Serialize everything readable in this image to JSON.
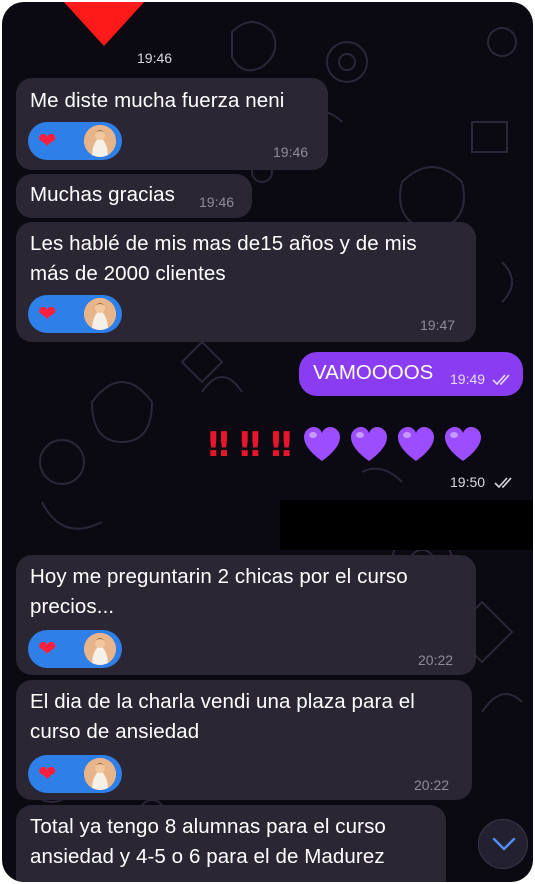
{
  "colors": {
    "background": "#0b0912",
    "incoming_bubble": "#2a2634",
    "outgoing_bubble": "#8a3cf0",
    "reaction_pill": "#2f7fe8",
    "heart_red": "#ff1f3d",
    "heart_purple": "#9b4dff"
  },
  "chat": {
    "top_time": "19:46",
    "messages": [
      {
        "text": "Me diste mucha fuerza neni",
        "time": "19:46",
        "reactions": [
          "red-heart-icon",
          "avatar"
        ]
      },
      {
        "text": "Muchas gracias",
        "time": "19:46"
      },
      {
        "text": "Les hablé de mis mas de15 años y de mis\nmás de 2000 clientes",
        "time": "19:47",
        "reactions": [
          "red-heart-icon",
          "avatar"
        ]
      },
      {
        "text": "VAMOOOOS",
        "time": "19:49",
        "outgoing": true,
        "status": "double-check-icon"
      },
      {
        "emoji": "‼️‼️‼️💜💜💜💜",
        "time": "19:50",
        "outgoing": true,
        "status": "double-check-icon"
      },
      {
        "text": "Hoy me preguntarin 2 chicas por el curso\nprecios...",
        "time": "20:22",
        "reactions": [
          "red-heart-icon",
          "avatar"
        ]
      },
      {
        "text": "El dia de la charla vendi una plaza para el\ncurso de ansiedad",
        "time": "20:22",
        "reactions": [
          "red-heart-icon",
          "avatar"
        ]
      },
      {
        "text": "Total ya tengo 8 alumnas para el curso\nansiedad y 4-5 o 6 para el de Madurez"
      }
    ],
    "bang": "‼",
    "scroll_button_icon": "chevron-down-icon"
  }
}
